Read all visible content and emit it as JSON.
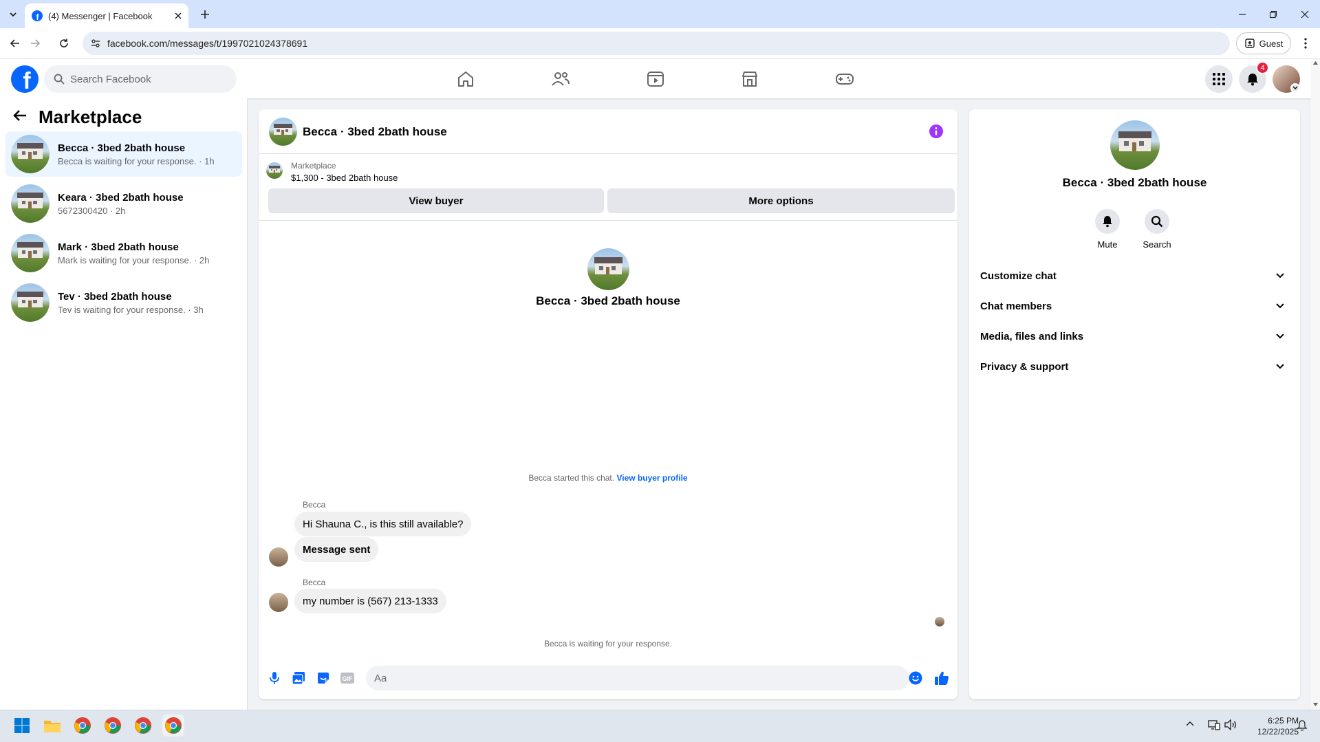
{
  "browser": {
    "tab_title": "(4) Messenger | Facebook",
    "url": "facebook.com/messages/t/1997021024378691",
    "profile_label": "Guest"
  },
  "fb": {
    "search_placeholder": "Search Facebook",
    "notification_count": "4"
  },
  "sidebar": {
    "title": "Marketplace",
    "conversations": [
      {
        "name": "Becca · 3bed 2bath house",
        "sub": "Becca is waiting for your response. · 1h",
        "active": true
      },
      {
        "name": "Keara · 3bed 2bath house",
        "sub": "5672300420 · 2h",
        "active": false
      },
      {
        "name": "Mark · 3bed 2bath house",
        "sub": "Mark is waiting for your response. · 2h",
        "active": false
      },
      {
        "name": "Tev · 3bed 2bath house",
        "sub": "Tev is waiting for your response. · 3h",
        "active": false
      }
    ]
  },
  "chat": {
    "title": "Becca · 3bed 2bath house",
    "context_label": "Marketplace",
    "listing": "$1,300 - 3bed 2bath house",
    "view_buyer_label": "View buyer",
    "more_options_label": "More options",
    "center_name": "Becca · 3bed 2bath house",
    "started_text": "Becca started this chat.",
    "view_profile_link": "View buyer profile",
    "messages": [
      {
        "sender": "Becca",
        "text": "Hi Shauna C., is this still available?"
      },
      {
        "sender": "",
        "text": "Message sent"
      },
      {
        "sender": "Becca",
        "text": "my number is (567) 213-1333"
      }
    ],
    "waiting_text": "Becca is waiting for your response.",
    "composer_placeholder": "Aa"
  },
  "details": {
    "name": "Becca · 3bed 2bath house",
    "actions": [
      "Mute",
      "Search"
    ],
    "sections": [
      "Customize chat",
      "Chat members",
      "Media, files and links",
      "Privacy & support"
    ]
  },
  "taskbar": {
    "time": "6:25 PM",
    "date": "12/22/2025"
  },
  "colors": {
    "fb_blue": "#0866ff",
    "active_row": "#ebf5ff",
    "badge_red": "#e41e3f",
    "info_purple": "#a033ff"
  }
}
